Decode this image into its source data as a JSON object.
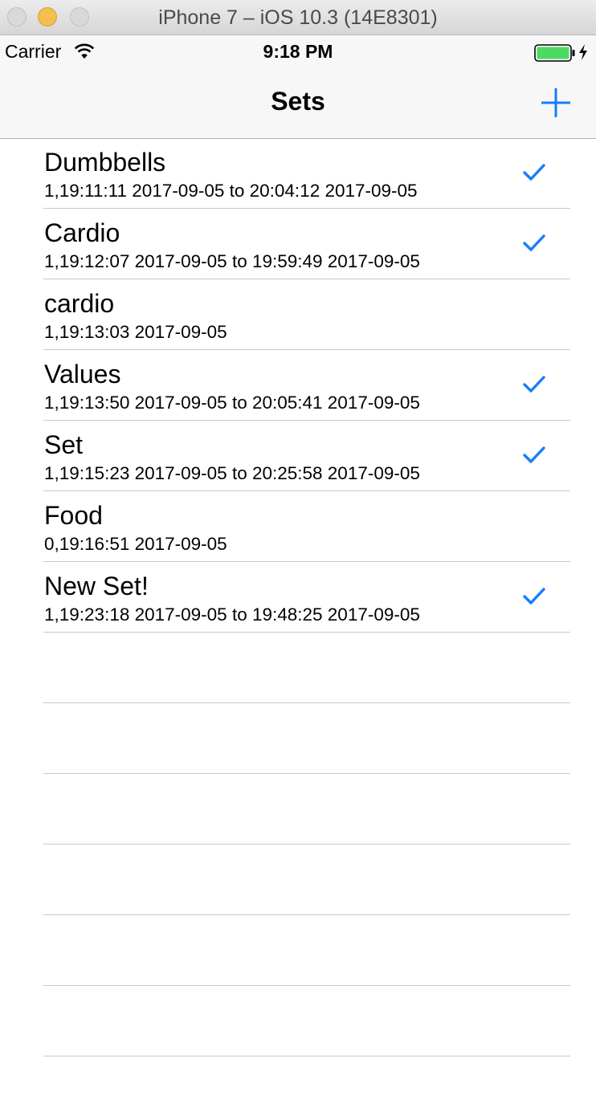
{
  "window": {
    "title": "iPhone 7 – iOS 10.3 (14E8301)"
  },
  "status_bar": {
    "carrier": "Carrier",
    "time": "9:18 PM"
  },
  "nav": {
    "title": "Sets",
    "add_icon": "plus-icon"
  },
  "colors": {
    "tint": "#157efb",
    "separator": "#c8c7cc"
  },
  "sets": [
    {
      "title": "Dumbbells",
      "subtitle": "1,19:11:11 2017-09-05 to 20:04:12 2017-09-05",
      "checked": true
    },
    {
      "title": "Cardio",
      "subtitle": "1,19:12:07 2017-09-05 to 19:59:49 2017-09-05",
      "checked": true
    },
    {
      "title": "cardio",
      "subtitle": "1,19:13:03 2017-09-05",
      "checked": false
    },
    {
      "title": "Values",
      "subtitle": "1,19:13:50 2017-09-05 to 20:05:41 2017-09-05",
      "checked": true
    },
    {
      "title": "Set",
      "subtitle": "1,19:15:23 2017-09-05 to 20:25:58 2017-09-05",
      "checked": true
    },
    {
      "title": "Food",
      "subtitle": "0,19:16:51 2017-09-05",
      "checked": false
    },
    {
      "title": "New Set!",
      "subtitle": "1,19:23:18 2017-09-05 to 19:48:25 2017-09-05",
      "checked": true
    }
  ]
}
